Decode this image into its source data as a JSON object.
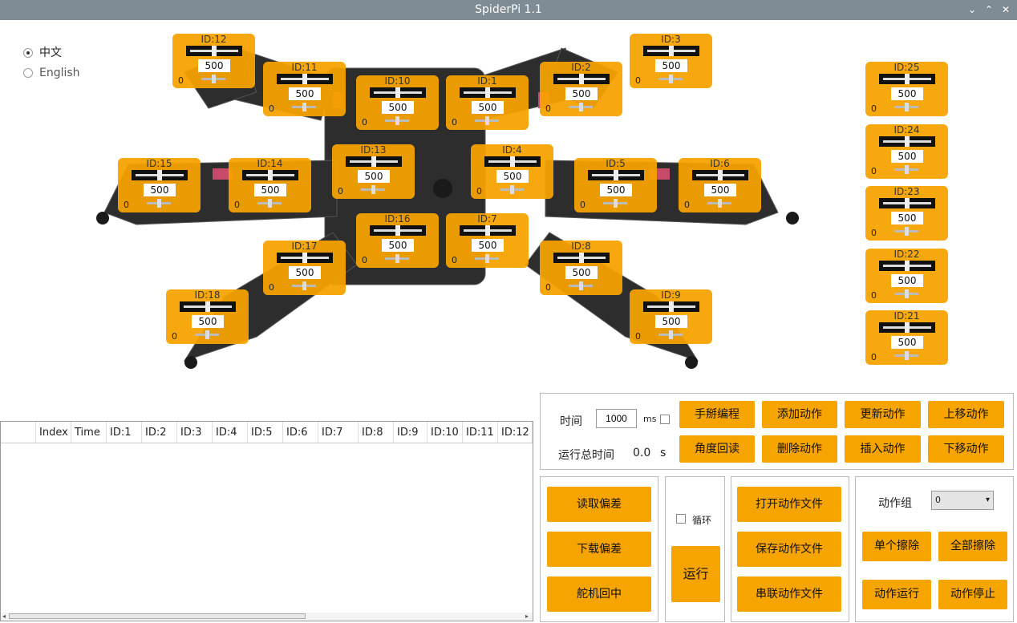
{
  "window": {
    "title": "SpiderPi 1.1",
    "minimize": "⌄",
    "maximize": "⌃",
    "close": "✕"
  },
  "language": {
    "chinese": "中文",
    "english": "English",
    "selected": "chinese"
  },
  "servo_panels": [
    {
      "id_label": "ID:12",
      "value": "500",
      "offset": "0"
    },
    {
      "id_label": "ID:3",
      "value": "500",
      "offset": "0"
    },
    {
      "id_label": "ID:11",
      "value": "500",
      "offset": "0"
    },
    {
      "id_label": "ID:2",
      "value": "500",
      "offset": "0"
    },
    {
      "id_label": "ID:10",
      "value": "500",
      "offset": "0"
    },
    {
      "id_label": "ID:1",
      "value": "500",
      "offset": "0"
    },
    {
      "id_label": "ID:15",
      "value": "500",
      "offset": "0"
    },
    {
      "id_label": "ID:14",
      "value": "500",
      "offset": "0"
    },
    {
      "id_label": "ID:13",
      "value": "500",
      "offset": "0"
    },
    {
      "id_label": "ID:4",
      "value": "500",
      "offset": "0"
    },
    {
      "id_label": "ID:5",
      "value": "500",
      "offset": "0"
    },
    {
      "id_label": "ID:6",
      "value": "500",
      "offset": "0"
    },
    {
      "id_label": "ID:16",
      "value": "500",
      "offset": "0"
    },
    {
      "id_label": "ID:7",
      "value": "500",
      "offset": "0"
    },
    {
      "id_label": "ID:17",
      "value": "500",
      "offset": "0"
    },
    {
      "id_label": "ID:8",
      "value": "500",
      "offset": "0"
    },
    {
      "id_label": "ID:18",
      "value": "500",
      "offset": "0"
    },
    {
      "id_label": "ID:9",
      "value": "500",
      "offset": "0"
    },
    {
      "id_label": "ID:25",
      "value": "500",
      "offset": "0"
    },
    {
      "id_label": "ID:24",
      "value": "500",
      "offset": "0"
    },
    {
      "id_label": "ID:23",
      "value": "500",
      "offset": "0"
    },
    {
      "id_label": "ID:22",
      "value": "500",
      "offset": "0"
    },
    {
      "id_label": "ID:21",
      "value": "500",
      "offset": "0"
    }
  ],
  "action_table": {
    "columns": [
      "Index",
      "Time",
      "ID:1",
      "ID:2",
      "ID:3",
      "ID:4",
      "ID:5",
      "ID:6",
      "ID:7",
      "ID:8",
      "ID:9",
      "ID:10",
      "ID:11",
      "ID:12"
    ],
    "rows": []
  },
  "timing": {
    "time_label": "时间",
    "time_value": "1000",
    "time_unit": "ms",
    "total_label": "运行总时间",
    "total_value": "0.0",
    "total_unit": "s"
  },
  "edit_buttons": {
    "manual": "手掰编程",
    "add": "添加动作",
    "update": "更新动作",
    "move_up": "上移动作",
    "read_angle": "角度回读",
    "delete": "删除动作",
    "insert": "插入动作",
    "move_down": "下移动作"
  },
  "deviation_buttons": {
    "read": "读取偏差",
    "download": "下载偏差",
    "center": "舵机回中"
  },
  "run_box": {
    "loop_label": "循环",
    "run": "运行"
  },
  "file_buttons": {
    "open": "打开动作文件",
    "save": "保存动作文件",
    "chain": "串联动作文件"
  },
  "group_box": {
    "label": "动作组",
    "selected": "0",
    "erase_one": "单个擦除",
    "erase_all": "全部擦除",
    "run": "动作运行",
    "stop": "动作停止"
  },
  "colors": {
    "accent": "#F6A400",
    "titlebar": "#7F8C96"
  },
  "icons": {
    "dropdown": "▾",
    "scroll_left": "◂",
    "scroll_right": "▸"
  }
}
